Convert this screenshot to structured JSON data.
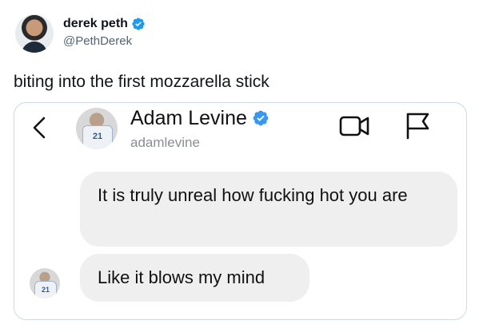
{
  "tweet": {
    "author_name": "derek peth",
    "author_handle": "@PethDerek",
    "text": "biting into the first mozzarella stick"
  },
  "screenshot": {
    "contact": {
      "name": "Adam Levine",
      "handle": "adamlevine",
      "jersey_number": "21"
    },
    "messages": [
      {
        "text": "It is truly unreal how fucking hot you are"
      },
      {
        "text": "Like it blows my mind"
      }
    ]
  },
  "colors": {
    "verified": "#1d9bf0",
    "bubble": "#efefef",
    "handle": "#536471",
    "contact_verified": "#3897f0"
  },
  "icons": [
    "verified-badge-icon",
    "chevron-left-icon",
    "video-camera-icon",
    "flag-icon"
  ]
}
